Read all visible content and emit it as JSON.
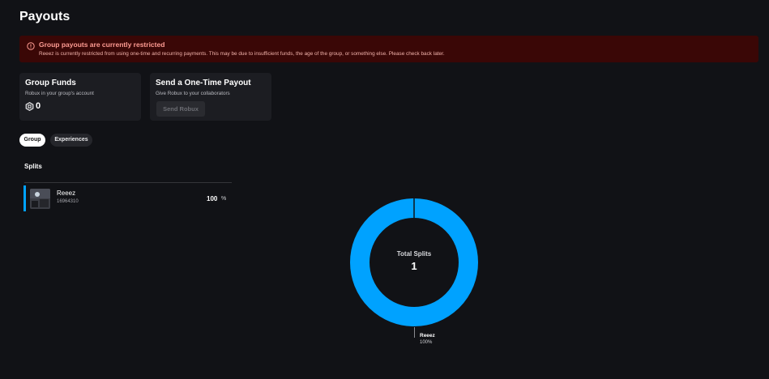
{
  "page": {
    "title": "Payouts"
  },
  "alert": {
    "title": "Group payouts are currently restricted",
    "body": "Reeez is currently restricted from using one-time and recurring payments. This may be due to insufficient funds, the age of the group, or something else. Please check back later.",
    "icon": "warning-circle-icon",
    "color": "#3a0706"
  },
  "funds": {
    "title": "Group Funds",
    "subtitle": "Robux in your group's account",
    "amount": "0",
    "icon": "robux-icon"
  },
  "payout": {
    "title": "Send a One-Time Payout",
    "subtitle": "Give Robux to your collaborators",
    "button_label": "Send Robux"
  },
  "tabs": [
    {
      "label": "Group",
      "active": true
    },
    {
      "label": "Experiences",
      "active": false
    }
  ],
  "splits": {
    "heading": "Splits",
    "rows": [
      {
        "name": "Reeez",
        "id": "16964310",
        "percent": "100",
        "percent_sign": "%"
      }
    ]
  },
  "chart_data": {
    "type": "pie",
    "center_label": "Total Splits",
    "center_value": "1",
    "slices": [
      {
        "label": "Reeez",
        "value": 100,
        "display": "100%",
        "color": "#00a2ff"
      }
    ]
  }
}
